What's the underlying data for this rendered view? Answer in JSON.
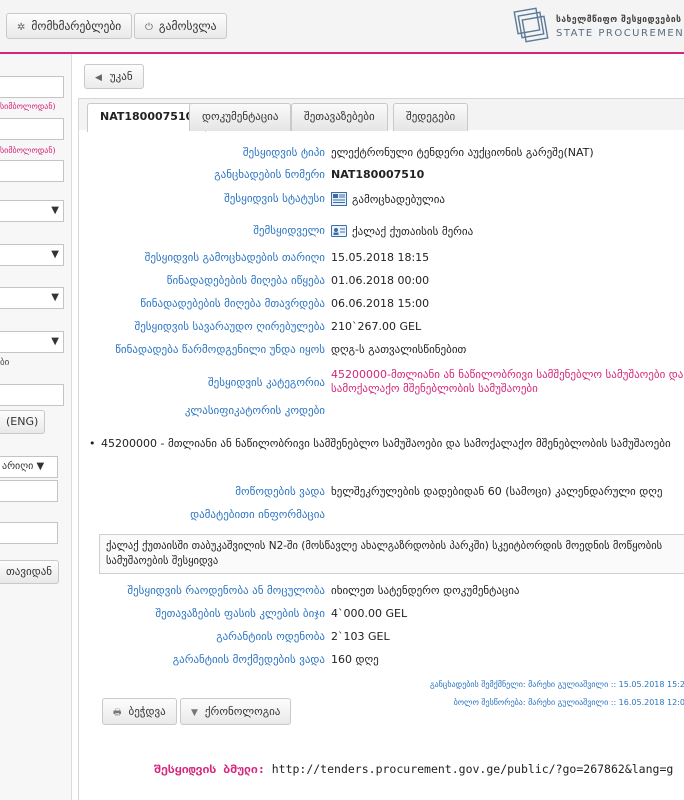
{
  "header": {
    "users_button": "მომხმარებლები",
    "logout_button": "გამოსვლა",
    "logo_line1": "სახელმწიფო შესყიდვების სააგ",
    "logo_line2": "STATE PROCUREMENT AG",
    "icons": {
      "users": "gear-icon",
      "logout": "power-icon"
    },
    "accent_color": "#d4267c"
  },
  "sidebar": {
    "hint1": "სიმბოლოდან)",
    "hint2": "სიმბოლოდან)",
    "small_text": "ბი",
    "eng_button": "(ENG)",
    "select_partial": "არიღი",
    "reset_button": "თავიდან"
  },
  "back_button": "უკან",
  "tabs": [
    "NAT180007510",
    "დოკუმენტაცია",
    "შეთავაზებები",
    "შედეგები"
  ],
  "details": [
    {
      "label": "შესყიდვის ტიპი",
      "value": "ელექტრონული ტენდერი აუქციონის გარეშე(NAT)"
    },
    {
      "label": "განცხადების ნომერი",
      "value": "NAT180007510"
    },
    {
      "label": "შესყიდვის სტატუსი",
      "value": "გამოცხადებულია",
      "icon": "status-doc-icon"
    },
    {
      "label": "შემსყიდველი",
      "value": "ქალაქ ქუთაისის მერია",
      "icon": "buyer-card-icon"
    },
    {
      "label": "შესყიდვის გამოცხადების თარიღი",
      "value": "15.05.2018 18:15"
    },
    {
      "label": "წინადადებების მიღება იწყება",
      "value": "01.06.2018 00:00"
    },
    {
      "label": "წინადადებების მიღება მთავრდება",
      "value": "06.06.2018 15:00"
    },
    {
      "label": "შესყიდვის სავარაუდო ღირებულება",
      "value": "210`267.00 GEL"
    },
    {
      "label": "წინადადება წარმოდგენილი უნდა იყოს",
      "value": "დღგ-ს გათვალისწინებით"
    },
    {
      "label": "შესყიდვის კატეგორია",
      "value": "45200000-მთლიანი ან ნაწილობრივი სამშენებლო სამუშაოები და სამოქალაქო მშენებლობის სამუშაოები"
    },
    {
      "label": "კლასიფიკატორის კოდები",
      "value": ""
    }
  ],
  "cpv_item": "45200000 - მთლიანი ან ნაწილობრივი სამშენებლო სამუშაოები და სამოქალაქო მშენებლობის სამუშაოები",
  "details2": [
    {
      "label": "მოწოდების ვადა",
      "value": "ხელშეკრულების დადებიდან 60 (სამოცი) კალენდარული დღე"
    },
    {
      "label": "დამატებითი ინფორმაცია",
      "value": ""
    }
  ],
  "description": "ქალაქ ქუთაისში თაბუკაშვილის N2-ში (მოსწავლე ახალგაზრდობის პარკში) სკეიტბორდის მოედნის მოწყობის სამუშაოების შესყიდვა",
  "details3": [
    {
      "label": "შესყიდვის რაოდენობა ან მოცულობა",
      "value": "იხილეთ სატენდერო დოკუმენტაცია"
    },
    {
      "label": "შეთავაზების ფასის კლების ბიჯი",
      "value": "4`000.00 GEL"
    },
    {
      "label": "გარანტიის ოდენობა",
      "value": "2`103 GEL"
    },
    {
      "label": "გარანტიის მოქმედების ვადა",
      "value": "160 დღე"
    }
  ],
  "meta": {
    "created": "განცხადების შემქმნელი: მარეხი გულიაშვილი :: 15.05.2018 15:2",
    "last_modified": "ბოლო შესწორება: მარეხი გულიაშვილი :: 16.05.2018 12:0"
  },
  "actions": {
    "print_button": "ბეჭდვა",
    "chronology_button": "ქრონოლოგია"
  },
  "link": {
    "label": "შესყიდვის ბმული:",
    "url": "http://tenders.procurement.gov.ge/public/?go=267862&lang=g"
  }
}
